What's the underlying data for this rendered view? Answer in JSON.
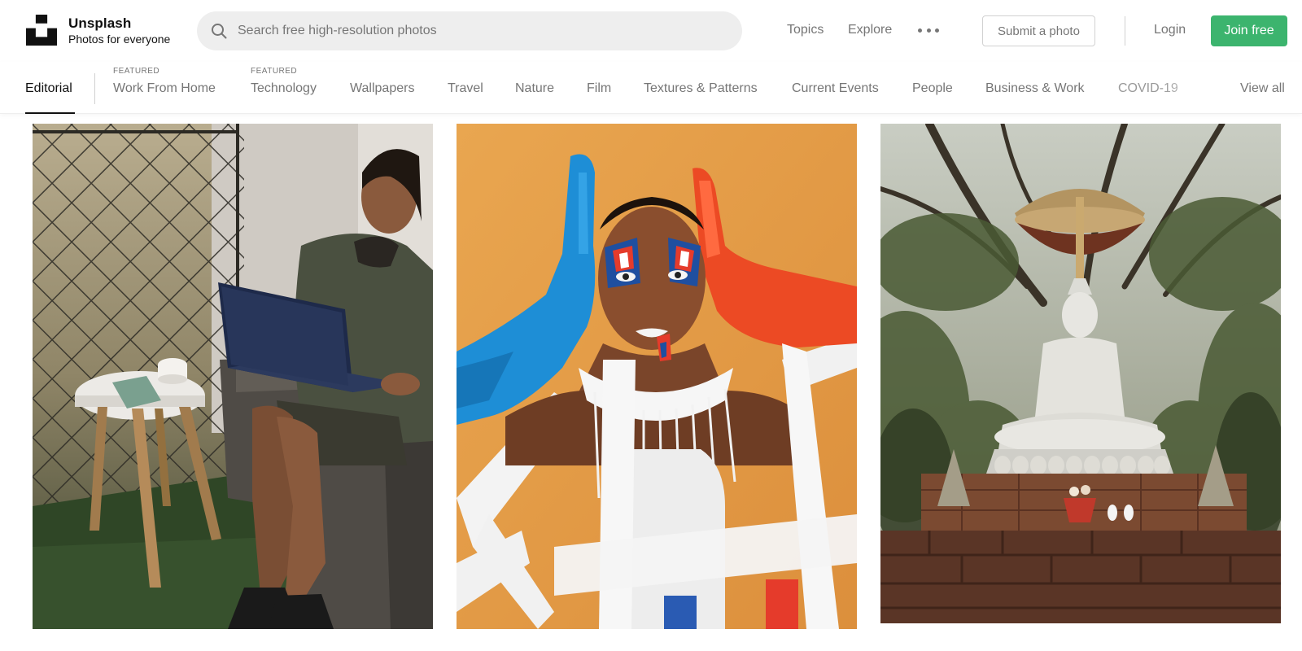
{
  "header": {
    "brand_name": "Unsplash",
    "brand_tagline": "Photos for everyone",
    "search_placeholder": "Search free high-resolution photos",
    "search_value": "",
    "nav_topics": "Topics",
    "nav_explore": "Explore",
    "more_icon": "more-horizontal-icon",
    "submit_label": "Submit a photo",
    "login_label": "Login",
    "join_label": "Join free",
    "join_color": "#3cb46e"
  },
  "topics": {
    "editorial": "Editorial",
    "featured_tag": "FEATURED",
    "items": [
      {
        "label": "Work From Home",
        "featured": true
      },
      {
        "label": "Technology",
        "featured": true
      },
      {
        "label": "Wallpapers",
        "featured": false
      },
      {
        "label": "Travel",
        "featured": false
      },
      {
        "label": "Nature",
        "featured": false
      },
      {
        "label": "Film",
        "featured": false
      },
      {
        "label": "Textures & Patterns",
        "featured": false
      },
      {
        "label": "Current Events",
        "featured": false
      },
      {
        "label": "People",
        "featured": false
      },
      {
        "label": "Business & Work",
        "featured": false
      },
      {
        "label": "COVID-19",
        "featured": false
      }
    ],
    "view_all": "View all"
  },
  "photos": [
    {
      "subject": "woman-with-laptop-on-balcony"
    },
    {
      "subject": "woman-with-painted-face-and-colored-gloves"
    },
    {
      "subject": "white-buddha-statue-under-trees"
    }
  ]
}
